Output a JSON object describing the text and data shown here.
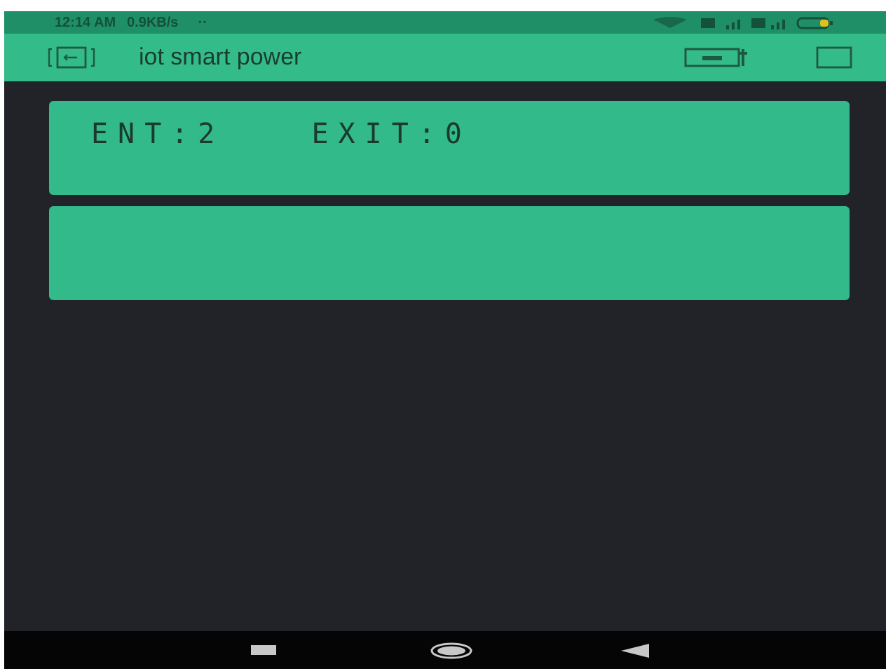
{
  "status_bar": {
    "time": "12:14 AM",
    "speed": "0.9KB/s",
    "dots": "··"
  },
  "header": {
    "title": "iot smart power"
  },
  "lcd_panels": [
    {
      "kind": "lcd",
      "texts": [
        "ENT:2",
        "EXIT:0"
      ]
    },
    {
      "kind": "lcd"
    }
  ]
}
